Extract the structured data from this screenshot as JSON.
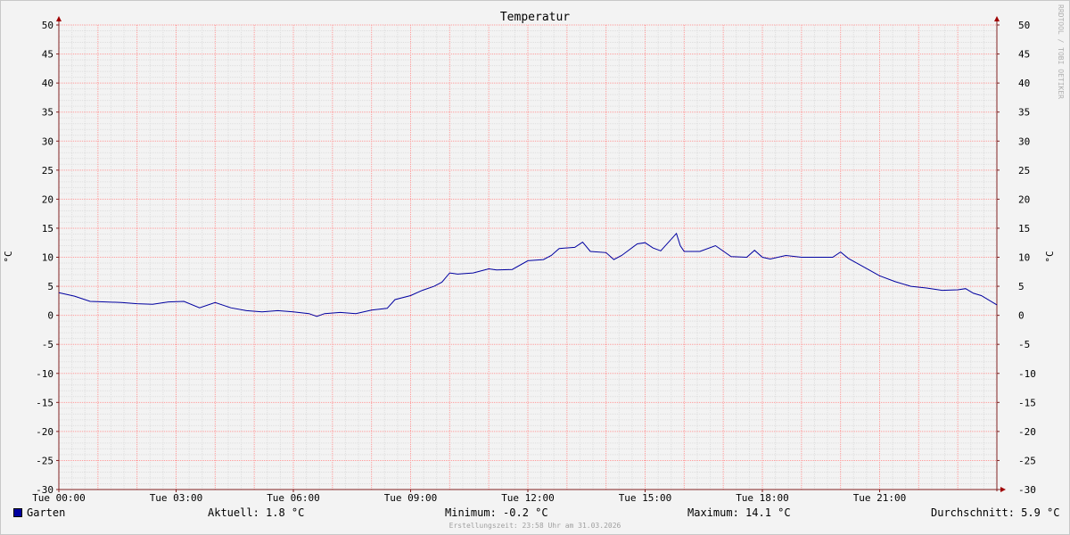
{
  "chart_data": {
    "type": "line",
    "title": "Temperatur",
    "ylabel": "°C",
    "ylim": [
      -30,
      50
    ],
    "yticks": [
      50,
      45,
      40,
      35,
      30,
      25,
      20,
      15,
      10,
      5,
      0,
      -5,
      -10,
      -15,
      -20,
      -25,
      -30
    ],
    "xlim": [
      0,
      24
    ],
    "xticks": [
      {
        "x": 0,
        "label": "Tue 00:00"
      },
      {
        "x": 3,
        "label": "Tue 03:00"
      },
      {
        "x": 6,
        "label": "Tue 06:00"
      },
      {
        "x": 9,
        "label": "Tue 09:00"
      },
      {
        "x": 12,
        "label": "Tue 12:00"
      },
      {
        "x": 15,
        "label": "Tue 15:00"
      },
      {
        "x": 18,
        "label": "Tue 18:00"
      },
      {
        "x": 21,
        "label": "Tue 21:00"
      }
    ],
    "grid": true,
    "series": [
      {
        "name": "Garten",
        "color": "#0000a0",
        "points": [
          [
            0,
            3.9
          ],
          [
            0.4,
            3.3
          ],
          [
            0.8,
            2.4
          ],
          [
            1.2,
            2.3
          ],
          [
            1.6,
            2.2
          ],
          [
            2.0,
            2.0
          ],
          [
            2.4,
            1.9
          ],
          [
            2.8,
            2.3
          ],
          [
            3.2,
            2.4
          ],
          [
            3.6,
            1.3
          ],
          [
            4.0,
            2.2
          ],
          [
            4.4,
            1.3
          ],
          [
            4.8,
            0.8
          ],
          [
            5.2,
            0.6
          ],
          [
            5.6,
            0.8
          ],
          [
            6.0,
            0.6
          ],
          [
            6.4,
            0.3
          ],
          [
            6.6,
            -0.2
          ],
          [
            6.8,
            0.3
          ],
          [
            7.2,
            0.5
          ],
          [
            7.6,
            0.3
          ],
          [
            8.0,
            0.9
          ],
          [
            8.4,
            1.2
          ],
          [
            8.6,
            2.7
          ],
          [
            9.0,
            3.4
          ],
          [
            9.3,
            4.3
          ],
          [
            9.6,
            5.0
          ],
          [
            9.8,
            5.7
          ],
          [
            10.0,
            7.3
          ],
          [
            10.2,
            7.1
          ],
          [
            10.6,
            7.3
          ],
          [
            11.0,
            8.0
          ],
          [
            11.2,
            7.8
          ],
          [
            11.6,
            7.9
          ],
          [
            12.0,
            9.4
          ],
          [
            12.4,
            9.6
          ],
          [
            12.6,
            10.3
          ],
          [
            12.8,
            11.5
          ],
          [
            13.2,
            11.7
          ],
          [
            13.4,
            12.6
          ],
          [
            13.6,
            11.0
          ],
          [
            14.0,
            10.8
          ],
          [
            14.2,
            9.6
          ],
          [
            14.4,
            10.3
          ],
          [
            14.8,
            12.3
          ],
          [
            15.0,
            12.5
          ],
          [
            15.2,
            11.6
          ],
          [
            15.4,
            11.1
          ],
          [
            15.6,
            12.6
          ],
          [
            15.8,
            14.1
          ],
          [
            15.9,
            12.0
          ],
          [
            16.0,
            11.0
          ],
          [
            16.4,
            11.0
          ],
          [
            16.8,
            12.0
          ],
          [
            17.2,
            10.1
          ],
          [
            17.6,
            10.0
          ],
          [
            17.8,
            11.2
          ],
          [
            18.0,
            10.0
          ],
          [
            18.2,
            9.7
          ],
          [
            18.6,
            10.3
          ],
          [
            19.0,
            10.0
          ],
          [
            19.4,
            10.0
          ],
          [
            19.8,
            10.0
          ],
          [
            20.0,
            10.9
          ],
          [
            20.2,
            9.8
          ],
          [
            20.6,
            8.3
          ],
          [
            21.0,
            6.8
          ],
          [
            21.4,
            5.8
          ],
          [
            21.8,
            5.0
          ],
          [
            22.2,
            4.7
          ],
          [
            22.6,
            4.3
          ],
          [
            23.0,
            4.4
          ],
          [
            23.2,
            4.6
          ],
          [
            23.4,
            3.8
          ],
          [
            23.6,
            3.4
          ],
          [
            24.0,
            1.8
          ]
        ]
      }
    ]
  },
  "side_label": "RRDTOOL / TOBI OETIKER",
  "legend": {
    "series_name": "Garten",
    "current": "Aktuell: 1.8 °C",
    "minimum": "Minimum: -0.2 °C",
    "maximum": "Maximum: 14.1 °C",
    "average": "Durchschnitt: 5.9 °C"
  },
  "footer": "Erstellungszeit: 23:58 Uhr am 31.03.2026",
  "colors": {
    "major_grid": "#ff9999",
    "minor_grid": "#dedede",
    "axis": "#802020",
    "line": "#0000a0"
  }
}
